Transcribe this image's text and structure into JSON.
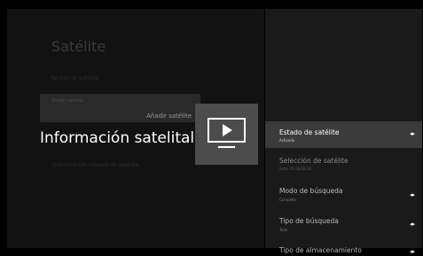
{
  "left": {
    "section_title": "Satélite",
    "item1": "Restaurar satélite",
    "selected_small": "Añadir satélite",
    "selected_label": "Añadir satélite",
    "item3": "Sintonización manual de satélite"
  },
  "overlay": {
    "title": "Información satelital",
    "tile_icon": "tv-play-icon"
  },
  "right": {
    "items": [
      {
        "label": "Estado de satélite",
        "value": "Activado",
        "arrows": "◂▸"
      },
      {
        "label": "Selección de satélite",
        "value": "Astra 19.2E/28.2E",
        "arrows": ""
      },
      {
        "label": "Modo de búsqueda",
        "value": "Completo",
        "arrows": "◂▸"
      },
      {
        "label": "Tipo de búsqueda",
        "value": "Todo",
        "arrows": "◂▸"
      },
      {
        "label": "Tipo de almacenamiento",
        "value": "",
        "arrows": "◂▸"
      }
    ]
  }
}
